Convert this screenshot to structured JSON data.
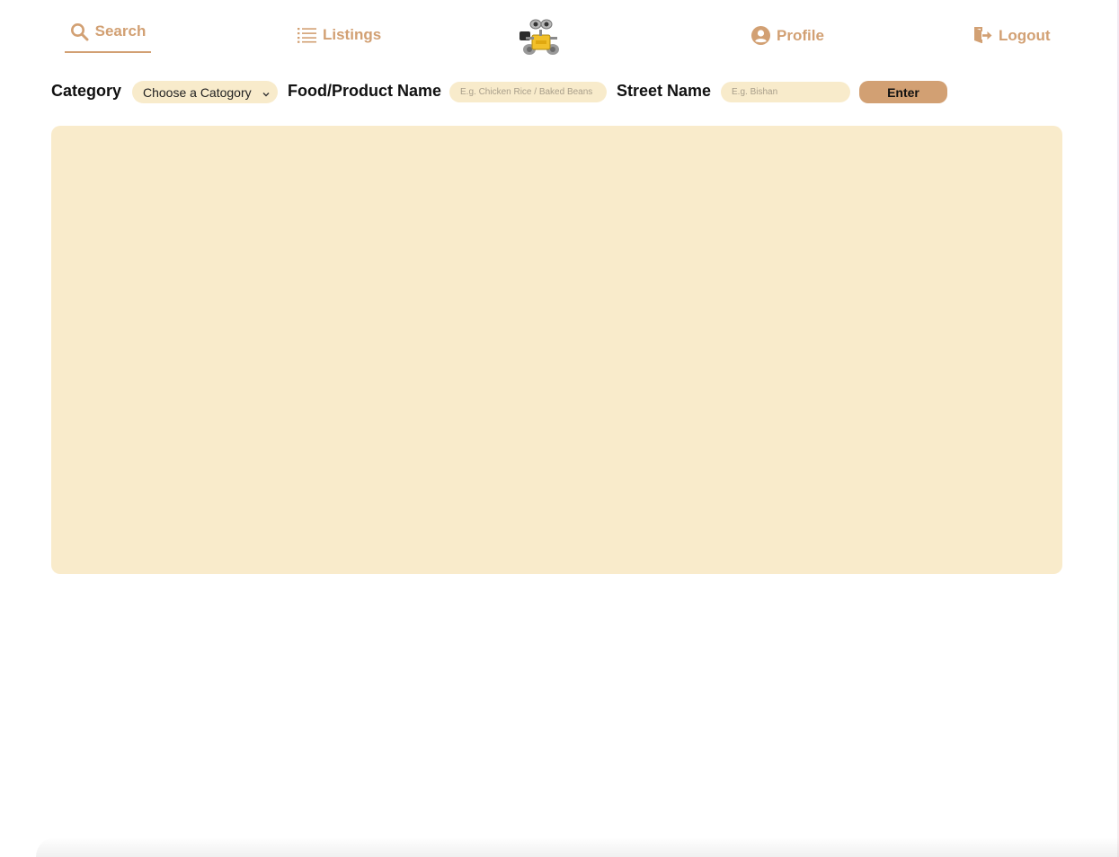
{
  "nav": {
    "search_label": "Search",
    "search_icon": "search-icon",
    "listings_label": "Listings",
    "listings_icon": "list-icon",
    "profile_label": "Profile",
    "profile_icon": "user-circle-icon",
    "logout_label": "Logout",
    "logout_icon": "logout-icon",
    "logo": "robot-mascot-logo",
    "accent_color": "#d2a073"
  },
  "filters": {
    "category_label": "Category",
    "category_selected": "Choose a Catogory",
    "food_label": "Food/Product Name",
    "food_placeholder": "E.g. Chicken Rice / Baked Beans",
    "street_label": "Street Name",
    "street_placeholder": "E.g. Bishan",
    "enter_label": "Enter",
    "field_color": "#f8ebcb"
  },
  "results": {
    "panel_color": "#f9ebcb"
  }
}
